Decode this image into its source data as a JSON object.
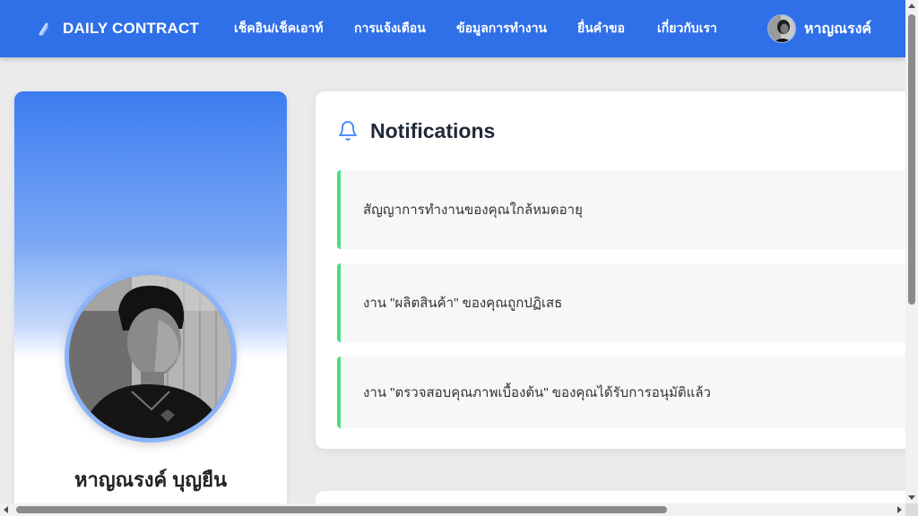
{
  "brand": {
    "name": "DAILY CONTRACT",
    "icon": "brand-logo-icon"
  },
  "nav": {
    "items": [
      {
        "label": "เช็คอิน/เช็คเอาท์"
      },
      {
        "label": "การแจ้งเตือน"
      },
      {
        "label": "ข้อมูลการทำงาน"
      },
      {
        "label": "ยื่นคำขอ"
      },
      {
        "label": "เกี่ยวกับเรา"
      }
    ],
    "user_name": "หาญณรงค์"
  },
  "profile": {
    "full_name": "หาญณรงค์ บุญยืน"
  },
  "notifications": {
    "title": "Notifications",
    "icon": "bell-icon",
    "items": [
      {
        "text": "สัญญาการทำงานของคุณใกล้หมดอายุ"
      },
      {
        "text": "งาน \"ผลิตสินค้า\" ของคุณถูกปฏิเสธ"
      },
      {
        "text": "งาน \"ตรวจสอบคุณภาพเบื้องต้น\" ของคุณได้รับการอนุมัติแล้ว"
      }
    ]
  },
  "colors": {
    "nav_bg": "#2f6fe8",
    "accent_border": "#4ade80",
    "page_bg": "#ebebeb"
  }
}
